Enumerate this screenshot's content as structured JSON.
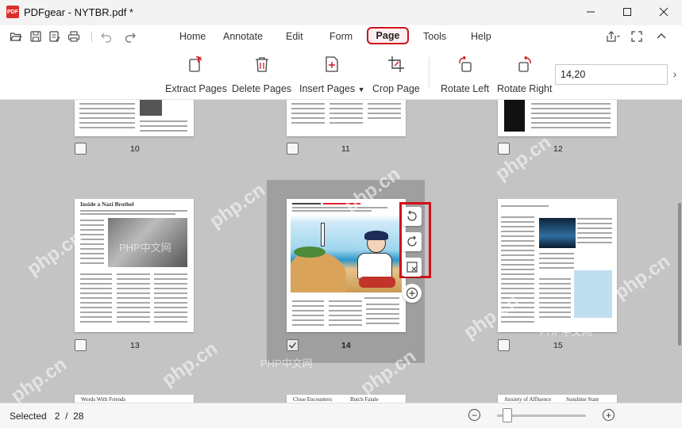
{
  "window": {
    "app_logo_text": "PDF",
    "title": "PDFgear - NYTBR.pdf *",
    "minimize_icon": "minimize-icon",
    "maximize_icon": "maximize-icon",
    "close_icon": "close-icon"
  },
  "quick_access": [
    "open-folder-icon",
    "save-icon",
    "save-as-icon",
    "print-icon",
    "undo-icon",
    "redo-icon"
  ],
  "menu": {
    "items": [
      {
        "label": "Home"
      },
      {
        "label": "Annotate"
      },
      {
        "label": "Edit"
      },
      {
        "label": "Form"
      },
      {
        "label": "Page",
        "active": true
      },
      {
        "label": "Tools"
      },
      {
        "label": "Help"
      }
    ],
    "right_icons": [
      "share-icon",
      "fullscreen-icon",
      "collapse-ribbon-icon"
    ]
  },
  "ribbon": {
    "tools": [
      {
        "label": "Extract Pages",
        "icon": "extract-pages-icon"
      },
      {
        "label": "Delete Pages",
        "icon": "delete-pages-icon"
      },
      {
        "label": "Insert Pages",
        "icon": "insert-pages-icon",
        "has_dropdown": true
      },
      {
        "label": "Crop Page",
        "icon": "crop-page-icon"
      },
      {
        "label": "Rotate Left",
        "icon": "rotate-left-icon"
      },
      {
        "label": "Rotate Right",
        "icon": "rotate-right-icon"
      }
    ],
    "page_range_value": "14,20"
  },
  "thumbnails": {
    "rows": [
      [
        {
          "page": "10",
          "checked": false
        },
        {
          "page": "11",
          "checked": false
        },
        {
          "page": "12",
          "checked": false
        }
      ],
      [
        {
          "page": "13",
          "checked": false,
          "heading": "Inside a Nazi Brothel"
        },
        {
          "page": "14",
          "checked": true
        },
        {
          "page": "15",
          "checked": false
        }
      ],
      [
        {
          "heading": "Words With Friends"
        },
        {
          "heading": "Close Encounters",
          "heading2": "Butch Fatale"
        },
        {
          "heading": "Anxiety of Affluence",
          "heading2": "Sunshine State"
        }
      ]
    ],
    "floating_toolbar": [
      "rotate-left-icon",
      "rotate-right-icon",
      "delete-page-icon",
      "insert-page-icon"
    ]
  },
  "watermarks": [
    "PHP中文网",
    "php.cn"
  ],
  "status": {
    "selected_label": "Selected",
    "selected_count": "2",
    "total_pages": "28",
    "zoom_level_fraction": 0.1
  }
}
